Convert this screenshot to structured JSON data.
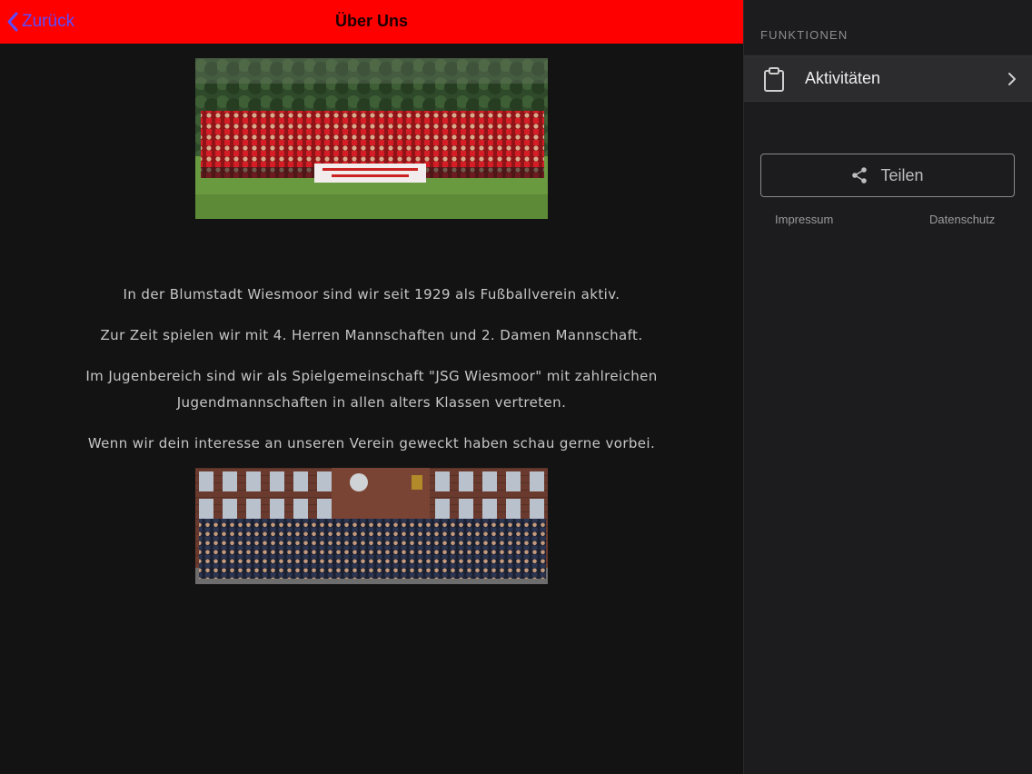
{
  "header": {
    "back_label": "Zurück",
    "title": "Über Uns",
    "bar_color": "#ff0000",
    "back_color": "#5b4cff"
  },
  "content": {
    "paragraphs": [
      "In der Blumstadt Wiesmoor sind wir seit 1929 als Fußballverein aktiv.",
      "Zur Zeit spielen wir mit 4. Herren Mannschaften und 2. Damen Mannschaft.",
      "Im Jugenbereich sind wir als Spielgemeinschaft \"JSG Wiesmoor\" mit zahlreichen Jugendmannschaften in allen alters Klassen vertreten.",
      "Wenn wir dein interesse an unseren Verein geweckt haben schau gerne vorbei."
    ]
  },
  "sidebar": {
    "section_title": "FUNKTIONEN",
    "items": [
      {
        "label": "Aktivitäten",
        "icon": "clipboard-icon"
      }
    ],
    "share_label": "Teilen",
    "footer": {
      "impressum": "Impressum",
      "datenschutz": "Datenschutz"
    }
  }
}
